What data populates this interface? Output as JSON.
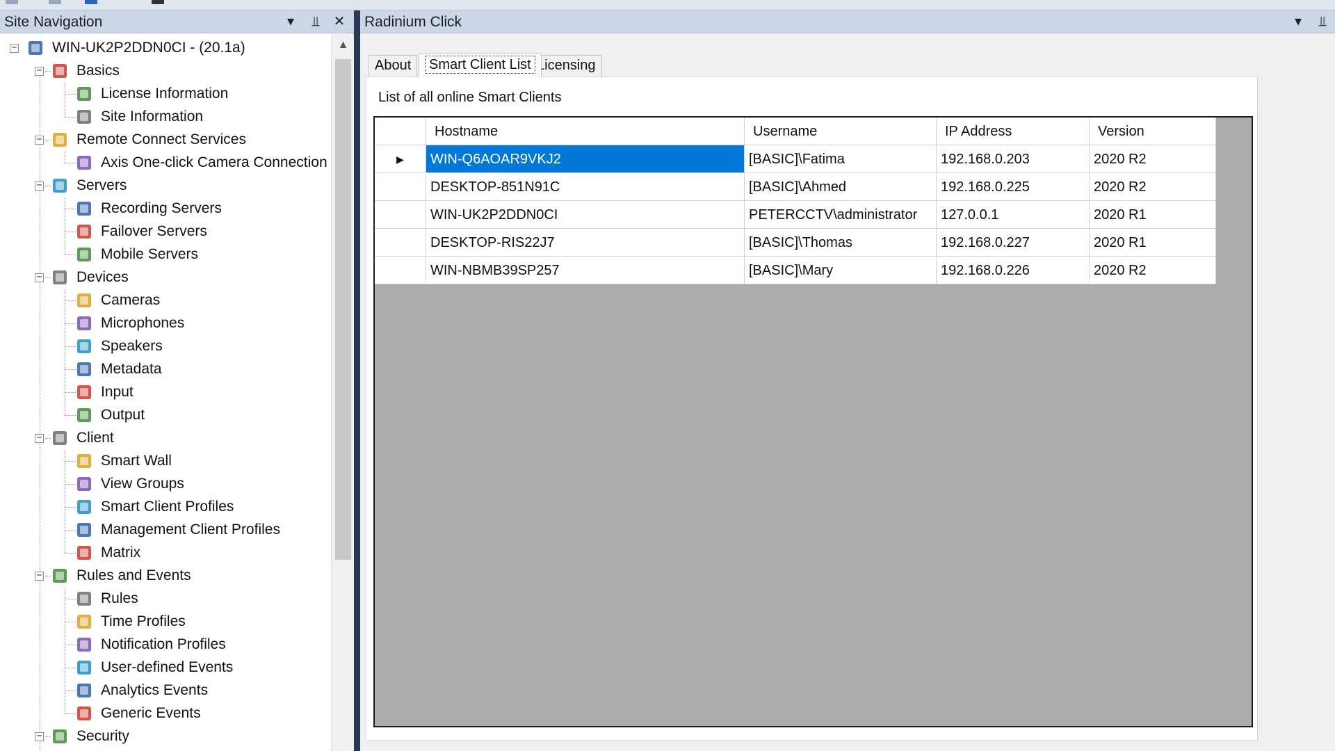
{
  "left_pane": {
    "title": "Site Navigation",
    "buttons": {
      "dropdown": "▾",
      "pin": "⫫",
      "close": "✕"
    },
    "tree": [
      {
        "label": "WIN-UK2P2DDN0CI - (20.1a)",
        "icon": "site-server-icon"
      },
      {
        "label": "Basics",
        "icon": "book-icon"
      },
      {
        "label": "License Information",
        "icon": "license-icon"
      },
      {
        "label": "Site Information",
        "icon": "site-info-icon"
      },
      {
        "label": "Remote Connect Services",
        "icon": "remote-services-icon"
      },
      {
        "label": "Axis One-click Camera Connection",
        "icon": "axis-camera-icon"
      },
      {
        "label": "Servers",
        "icon": "servers-icon"
      },
      {
        "label": "Recording Servers",
        "icon": "recording-server-icon"
      },
      {
        "label": "Failover Servers",
        "icon": "failover-server-icon"
      },
      {
        "label": "Mobile Servers",
        "icon": "mobile-server-icon"
      },
      {
        "label": "Devices",
        "icon": "devices-icon"
      },
      {
        "label": "Cameras",
        "icon": "camera-icon"
      },
      {
        "label": "Microphones",
        "icon": "microphone-icon"
      },
      {
        "label": "Speakers",
        "icon": "speaker-icon"
      },
      {
        "label": "Metadata",
        "icon": "metadata-icon"
      },
      {
        "label": "Input",
        "icon": "input-icon"
      },
      {
        "label": "Output",
        "icon": "lightbulb-icon"
      },
      {
        "label": "Client",
        "icon": "monitor-icon"
      },
      {
        "label": "Smart Wall",
        "icon": "smart-wall-icon"
      },
      {
        "label": "View Groups",
        "icon": "folder-icon"
      },
      {
        "label": "Smart Client Profiles",
        "icon": "smart-client-profile-icon"
      },
      {
        "label": "Management Client Profiles",
        "icon": "management-profile-icon"
      },
      {
        "label": "Matrix",
        "icon": "matrix-icon"
      },
      {
        "label": "Rules and Events",
        "icon": "rules-events-icon"
      },
      {
        "label": "Rules",
        "icon": "rules-icon"
      },
      {
        "label": "Time Profiles",
        "icon": "clock-icon"
      },
      {
        "label": "Notification Profiles",
        "icon": "envelope-icon"
      },
      {
        "label": "User-defined Events",
        "icon": "user-event-icon"
      },
      {
        "label": "Analytics Events",
        "icon": "analytics-event-icon"
      },
      {
        "label": "Generic Events",
        "icon": "generic-event-icon"
      },
      {
        "label": "Security",
        "icon": "security-icon"
      }
    ]
  },
  "right_pane": {
    "title": "Radinium Click",
    "buttons": {
      "dropdown": "▾",
      "pin": "⫫"
    },
    "tabs": [
      "About",
      "Smart Client List",
      "Licensing"
    ],
    "active_tab": "Smart Client List",
    "caption": "List of all online Smart Clients",
    "grid": {
      "columns": [
        "Hostname",
        "Username",
        "IP Address",
        "Version"
      ],
      "current_row_marker": "▶",
      "rows": [
        [
          "WIN-Q6AOAR9VKJ2",
          "[BASIC]\\Fatima",
          "192.168.0.203",
          "2020 R2"
        ],
        [
          "DESKTOP-851N91C",
          "[BASIC]\\Ahmed",
          "192.168.0.225",
          "2020 R2"
        ],
        [
          "WIN-UK2P2DDN0CI",
          "PETERCCTV\\administrator",
          "127.0.0.1",
          "2020 R1"
        ],
        [
          "DESKTOP-RIS22J7",
          "[BASIC]\\Thomas",
          "192.168.0.227",
          "2020 R1"
        ],
        [
          "WIN-NBMB39SP257",
          "[BASIC]\\Mary",
          "192.168.0.226",
          "2020 R2"
        ]
      ]
    }
  },
  "colors": {
    "selection": "#0078d7",
    "header_bar": "#cbd6e6",
    "grid_background": "#ababab",
    "chrome": "#293955"
  }
}
